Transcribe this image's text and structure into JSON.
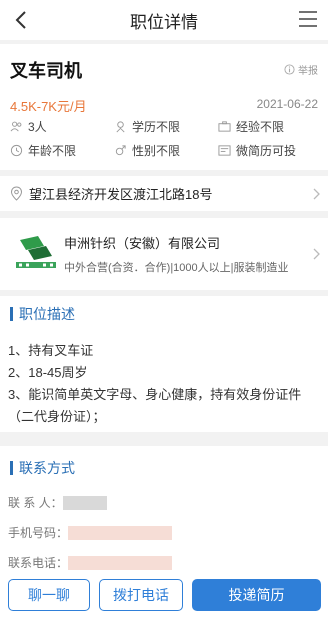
{
  "header": {
    "title": "职位详情"
  },
  "job": {
    "title": "叉车司机",
    "report_label": "举报",
    "salary": "4.5K-7K元/月",
    "date": "2021-06-22",
    "requirements": [
      {
        "icon": "people-icon",
        "text": "3人"
      },
      {
        "icon": "education-icon",
        "text": "学历不限"
      },
      {
        "icon": "briefcase-icon",
        "text": "经验不限"
      },
      {
        "icon": "clock-icon",
        "text": "年龄不限"
      },
      {
        "icon": "gender-icon",
        "text": "性别不限"
      },
      {
        "icon": "resume-icon",
        "text": "微简历可投"
      }
    ]
  },
  "address": {
    "text": "望江县经济开发区渡江北路18号"
  },
  "company": {
    "name": "申洲针织（安徽）有限公司",
    "info": "中外合营(合资．合作)|1000人以上|服装制造业"
  },
  "description": {
    "heading": "职位描述",
    "lines": [
      "1、持有叉车证",
      "2、18-45周岁",
      "3、能识简单英文字母、身心健康，持有效身份证件",
      "（二代身份证）；"
    ]
  },
  "contact": {
    "heading": "联系方式",
    "rows": [
      {
        "label": "联 系 人："
      },
      {
        "label": "手机号码："
      },
      {
        "label": "联系电话："
      }
    ]
  },
  "actions": {
    "chat_label": "聊一聊",
    "call_label": "拨打电话",
    "apply_label": "投递简历"
  },
  "colors": {
    "accent": "#2f7fd8",
    "salary": "#e8773a",
    "heading": "#2a6fb5"
  }
}
